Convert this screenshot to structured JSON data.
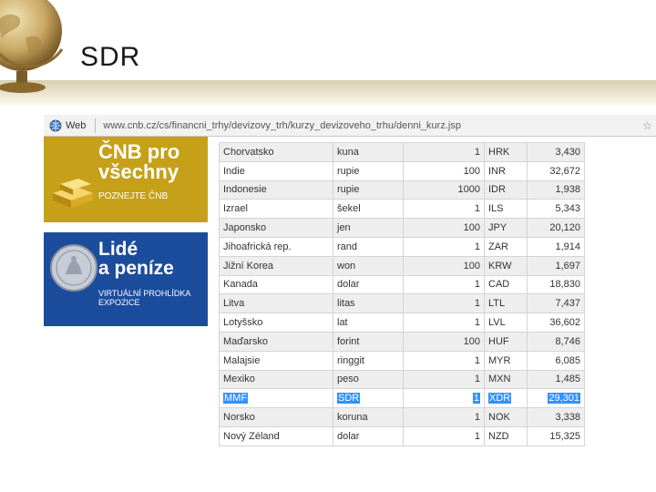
{
  "slide": {
    "title": "SDR"
  },
  "browser": {
    "tab_label": "Web",
    "url": "www.cnb.cz/cs/financni_trhy/devizovy_trh/kurzy_devizoveho_trhu/denni_kurz.jsp"
  },
  "banners": {
    "cnb": {
      "line1": "ČNB pro",
      "line2": "všechny",
      "sub": "POZNEJTE ČNB",
      "color": "#c6a018"
    },
    "lide": {
      "line1": "Lidé",
      "line2": "a peníze",
      "sub1": "VIRTUÁLNÍ PROHLÍDKA",
      "sub2": "EXPOZICE",
      "color": "#1c4c9c"
    }
  },
  "rates": [
    {
      "country": "Chorvatsko",
      "currency": "kuna",
      "amount": "1",
      "code": "HRK",
      "rate": "3,430"
    },
    {
      "country": "Indie",
      "currency": "rupie",
      "amount": "100",
      "code": "INR",
      "rate": "32,672"
    },
    {
      "country": "Indonesie",
      "currency": "rupie",
      "amount": "1000",
      "code": "IDR",
      "rate": "1,938"
    },
    {
      "country": "Izrael",
      "currency": "šekel",
      "amount": "1",
      "code": "ILS",
      "rate": "5,343"
    },
    {
      "country": "Japonsko",
      "currency": "jen",
      "amount": "100",
      "code": "JPY",
      "rate": "20,120"
    },
    {
      "country": "Jihoafrická rep.",
      "currency": "rand",
      "amount": "1",
      "code": "ZAR",
      "rate": "1,914"
    },
    {
      "country": "Jižní Korea",
      "currency": "won",
      "amount": "100",
      "code": "KRW",
      "rate": "1,697"
    },
    {
      "country": "Kanada",
      "currency": "dolar",
      "amount": "1",
      "code": "CAD",
      "rate": "18,830"
    },
    {
      "country": "Litva",
      "currency": "litas",
      "amount": "1",
      "code": "LTL",
      "rate": "7,437"
    },
    {
      "country": "Lotyšsko",
      "currency": "lat",
      "amount": "1",
      "code": "LVL",
      "rate": "36,602"
    },
    {
      "country": "Maďarsko",
      "currency": "forint",
      "amount": "100",
      "code": "HUF",
      "rate": "8,746"
    },
    {
      "country": "Malajsie",
      "currency": "ringgit",
      "amount": "1",
      "code": "MYR",
      "rate": "6,085"
    },
    {
      "country": "Mexiko",
      "currency": "peso",
      "amount": "1",
      "code": "MXN",
      "rate": "1,485"
    },
    {
      "country": "MMF",
      "currency": "SDR",
      "amount": "1",
      "code": "XDR",
      "rate": "29,301"
    },
    {
      "country": "Norsko",
      "currency": "koruna",
      "amount": "1",
      "code": "NOK",
      "rate": "3,338"
    },
    {
      "country": "Nový Zéland",
      "currency": "dolar",
      "amount": "1",
      "code": "NZD",
      "rate": "15,325"
    }
  ],
  "highlighted_row": 13,
  "colors": {
    "selection": "#3390ff",
    "stripe": "#eeeeee"
  }
}
